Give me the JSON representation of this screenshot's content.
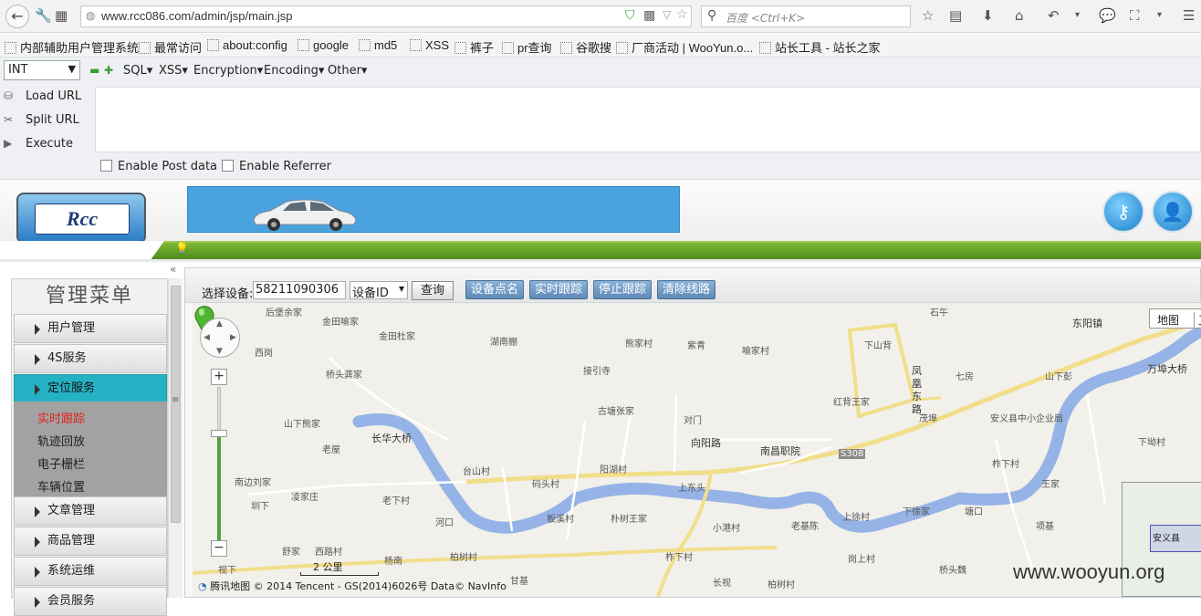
{
  "browser": {
    "url": "www.rcc086.com/admin/jsp/main.jsp",
    "search_placeholder": "百度 <Ctrl+K>"
  },
  "bookmarks": [
    "内部辅助用户管理系统",
    "最常访问",
    "about:config",
    "google",
    "md5",
    "XSS",
    "裤子",
    "pr查询",
    "谷歌搜",
    "厂商活动 | WooYun.o...",
    "站长工具 - 站长之家"
  ],
  "hackbar": {
    "type_select": "INT",
    "menus": [
      "SQL",
      "XSS",
      "Encryption",
      "Encoding",
      "Other"
    ],
    "load_url": "Load URL",
    "split_url": "Split URL",
    "execute": "Execute",
    "enable_post": "Enable Post data",
    "enable_referrer": "Enable Referrer"
  },
  "app": {
    "logo_text": "Rcc"
  },
  "sidebar": {
    "title": "管理菜单",
    "items": [
      "用户管理",
      "4S服务",
      "定位服务",
      "文章管理",
      "商品管理",
      "系统运维",
      "会员服务"
    ],
    "sub_items": [
      "实时跟踪",
      "轨迹回放",
      "电子栅栏",
      "车辆位置"
    ]
  },
  "toolbar": {
    "select_device_label": "选择设备:",
    "device_value": "58211090306",
    "device_type": "设备ID",
    "query_btn": "查询",
    "buttons": [
      "设备点名",
      "实时跟踪",
      "停止跟踪",
      "清除线路"
    ]
  },
  "map": {
    "type_map": "地图",
    "type_sat": "卫",
    "footer": "腾讯地图 © 2014 Tencent - GS(2014)6026号  Data© NavInfo",
    "scale": "2 公里",
    "minimap_label": "安义县",
    "places": [
      "后堡余家",
      "金田喻家",
      "石午",
      "东阳镇",
      "西岗",
      "金田杜家",
      "湖南棚",
      "熊家村",
      "紫青",
      "喻家村",
      "下山背",
      "桥头龚家",
      "接引寺",
      "七房",
      "山下彭",
      "万埠大桥",
      "古塘张家",
      "对门",
      "红背王家",
      "凤凰东路",
      "茂埠",
      "安义县中小企业局",
      "下坳村",
      "山下熊家",
      "老屋",
      "长华大桥",
      "向阳路",
      "南昌职院",
      "S308",
      "柞下村",
      "南边刘家",
      "台山村",
      "码头村",
      "阳湖村",
      "上东头",
      "王家",
      "圳下",
      "凌家庄",
      "老下村",
      "河口",
      "板溪村",
      "朴树王家",
      "小港村",
      "老基陈",
      "上徐村",
      "下徐家",
      "塘口",
      "项基",
      "舒家",
      "西路村",
      "柏树村",
      "柞下村",
      "岗上村",
      "桥头魏",
      "视下",
      "杨南",
      "甘基",
      "长视",
      "柏树村"
    ]
  },
  "watermark": "www.wooyun.org"
}
